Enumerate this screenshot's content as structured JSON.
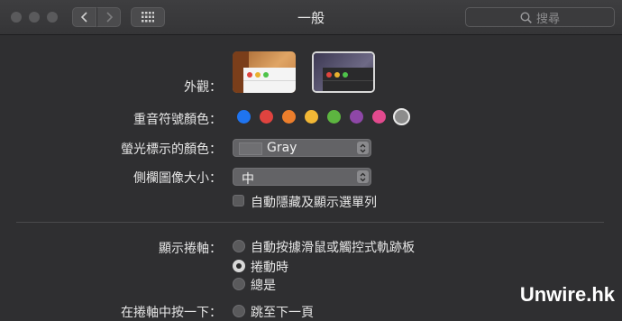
{
  "window": {
    "title": "一般"
  },
  "search": {
    "placeholder": "搜尋"
  },
  "appearance": {
    "label": "外觀："
  },
  "accent": {
    "label": "重音符號顏色：",
    "colors": [
      "#1f74f0",
      "#e0433f",
      "#ec7e2c",
      "#f2b735",
      "#5db540",
      "#8e47a7",
      "#e24a8e",
      "#8c8c8c"
    ],
    "selected": "#8c8c8c"
  },
  "highlight": {
    "label": "螢光標示的顏色：",
    "value": "Gray"
  },
  "sidebar_size": {
    "label": "側欄圖像大小：",
    "value": "中"
  },
  "auto_hide_menu": {
    "label": "自動隱藏及顯示選單列",
    "checked": false
  },
  "scrollbars": {
    "label": "顯示捲軸：",
    "options": [
      "自動按據滑鼠或觸控式軌跡板",
      "捲動時",
      "總是"
    ],
    "selected_index": 1
  },
  "partial_row": {
    "label": "在捲軸中按一下：",
    "option": "跳至下一頁"
  },
  "watermark": "Unwire.hk"
}
